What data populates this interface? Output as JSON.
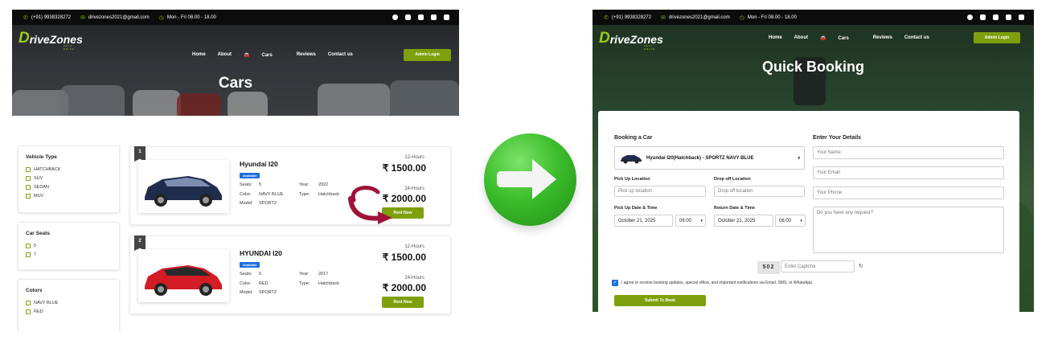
{
  "topbar": {
    "phone": "(+91) 9938328272",
    "email": "drivezones2021@gmail.com",
    "hours": "Mon - Fri 08.00 - 18.00",
    "socials": [
      "facebook-icon",
      "twitter-icon",
      "youtube-icon",
      "instagram-icon",
      "store-icon"
    ]
  },
  "brand": {
    "logo_initial": "D",
    "logo_rest": "riveZones",
    "tagline": "SELF DRIVE"
  },
  "nav": {
    "items": [
      "Home",
      "About",
      "Cars",
      "Reviews",
      "Contact us"
    ],
    "admin_label": "Admin Login"
  },
  "left": {
    "hero_title": "Cars",
    "filters": [
      {
        "title": "Vehicle Type",
        "options": [
          "HATCHBACK",
          "SUV",
          "SEDAN",
          "MUV"
        ]
      },
      {
        "title": "Car Seats",
        "options": [
          "5",
          "7"
        ]
      },
      {
        "title": "Colors",
        "options": [
          "NAVY BLUE",
          "RED"
        ]
      }
    ],
    "cars": [
      {
        "number": "1",
        "name": "Hyundai I20",
        "badge": "Available",
        "seats_label": "Seats:",
        "seats": "5",
        "color_label": "Color:",
        "color": "NAVY BLUE",
        "model_label": "Model:",
        "model": "SPORTZ",
        "year_label": "Year:",
        "year": "2022",
        "type_label": "Type:",
        "type": "Hatchback",
        "price12_label": "12-Hours",
        "price12": "₹ 1500.00",
        "price24_label": "24-Hours",
        "price24": "₹ 2000.00",
        "rent_label": "Rent Now",
        "body_color": "#1f2d4d"
      },
      {
        "number": "2",
        "name": "HYUNDAI I20",
        "badge": "Available",
        "seats_label": "Seats:",
        "seats": "5",
        "color_label": "Color:",
        "color": "RED",
        "model_label": "Model:",
        "model": "SPORTZ",
        "year_label": "Year:",
        "year": "2017",
        "type_label": "Type:",
        "type": "Hatchback",
        "price12_label": "12-Hours",
        "price12": "₹ 1500.00",
        "price24_label": "24-Hours",
        "price24": "₹ 2000.00",
        "rent_label": "Rent Now",
        "body_color": "#d31c24"
      }
    ]
  },
  "right": {
    "hero_title": "Quick Booking",
    "booking_heading": "Booking a Car",
    "details_heading": "Enter Your Details",
    "selected_car": "Hyundai I20(Hatchback) - SPORTZ NAVY BLUE",
    "pickup_label": "Pick Up Location",
    "pickup_placeholder": "Pick up location",
    "dropoff_label": "Drop off Location",
    "dropoff_placeholder": "Drop off location",
    "pickup_dt_label": "Pick Up Date & Time",
    "return_dt_label": "Return Date & Time",
    "pickup_date": "October 21, 2025",
    "pickup_time": "06:00",
    "return_date": "October 21, 2025",
    "return_time": "06:00",
    "name_placeholder": "Your Name",
    "email_placeholder": "Your Email",
    "phone_placeholder": "Your Phone",
    "request_placeholder": "Do you have any request?",
    "captcha_code": "502",
    "captcha_placeholder": "Enter Captcha",
    "consent_text": "I agree to receive booking updates, special offers, and important notifications via Email, SMS, or WhatsApp.",
    "submit_label": "Submit To Book"
  },
  "colors": {
    "accent": "#7ea00d",
    "brand_green": "#9acd1a",
    "badge_blue": "#1e6fd9",
    "topbar": "#0c0c0c",
    "arrow_green": "#3bbd2b",
    "annotation_arrow": "#a0123a"
  }
}
